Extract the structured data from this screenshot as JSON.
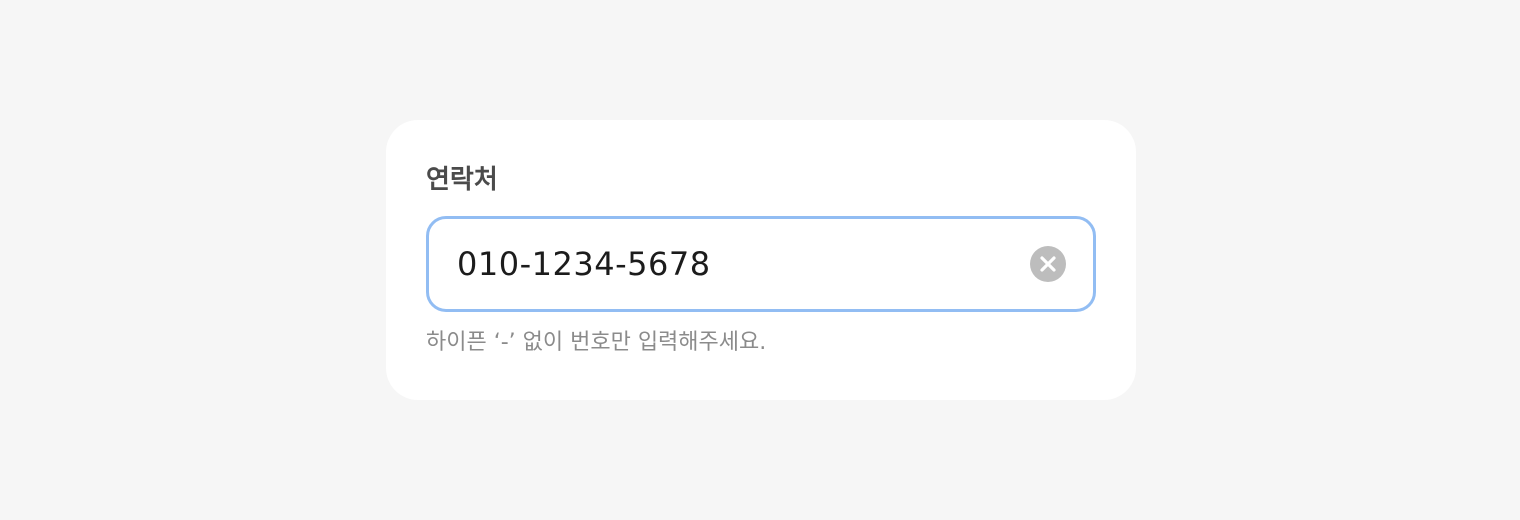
{
  "contact_form": {
    "label": "연락처",
    "phone_value": "010-1234-5678",
    "helper_text": "하이픈 ‘-’ 없이 번호만 입력해주세요.",
    "clear_icon": "close-circle-icon",
    "focus_color": "#92bdf3"
  }
}
